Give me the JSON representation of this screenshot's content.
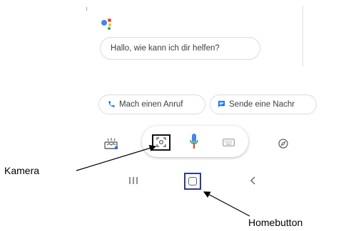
{
  "assistant": {
    "greeting": "Hallo, wie kann ich dir helfen?"
  },
  "suggestions": [
    {
      "label": "Mach einen Anruf",
      "icon": "phone-icon"
    },
    {
      "label": "Sende eine Nachr",
      "icon": "message-icon"
    }
  ],
  "toolbar": {
    "snapshot_icon": "snapshot-icon",
    "lens_icon": "lens-icon",
    "mic_icon": "mic-icon",
    "keyboard_icon": "keyboard-icon",
    "explore_icon": "compass-icon"
  },
  "navbar": {
    "recents_icon": "recents-icon",
    "home_icon": "home-icon",
    "back_icon": "back-icon"
  },
  "annotations": {
    "kamera": "Kamera",
    "homebutton": "Homebutton"
  },
  "colors": {
    "google_blue": "#4285F4",
    "google_red": "#EA4335",
    "google_yellow": "#FBBC05",
    "google_green": "#34A853",
    "highlight_border": "#2e3a8c"
  }
}
